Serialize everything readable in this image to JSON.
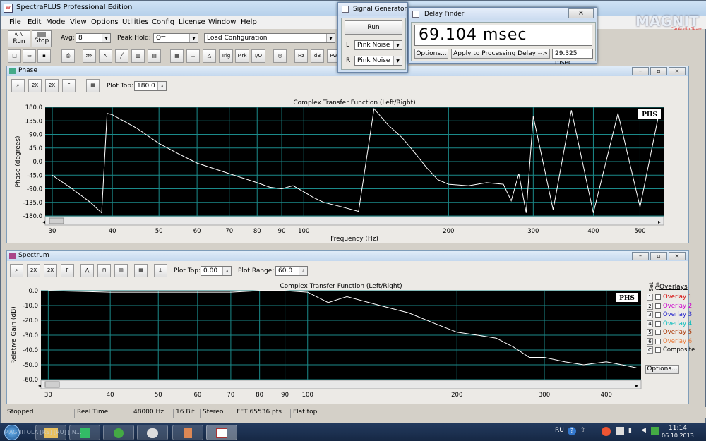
{
  "app": {
    "title": "SpectraPLUS Professional Edition"
  },
  "menu": [
    "File",
    "Edit",
    "Mode",
    "View",
    "Options",
    "Utilities",
    "Config",
    "License",
    "Window",
    "Help"
  ],
  "toolbar": {
    "run_label": "Run",
    "stop_label": "Stop",
    "avg_label": "Avg:",
    "avg_value": "8",
    "peak_label": "Peak Hold:",
    "peak_value": "Off",
    "config_value": "Load Configuration",
    "icons": [
      "Trig",
      "Mrk",
      "I/O",
      "Hz",
      "dB",
      "Pw"
    ]
  },
  "signal_generator": {
    "title": "Signal Generator",
    "run_label": "Run",
    "l_label": "L",
    "l_value": "Pink Noise",
    "r_label": "R",
    "r_value": "Pink Noise"
  },
  "delay_finder": {
    "title": "Delay Finder",
    "readout": "69.104 msec",
    "options_label": "Options...",
    "apply_label": "Apply to Processing Delay -->",
    "delay_value": "29.325 msec"
  },
  "watermark": {
    "brand": "MAGNIT",
    "sub": "CarAudio Team"
  },
  "phase": {
    "window_title": "Phase",
    "plot_top_label": "Plot Top:",
    "plot_top_value": "180.0",
    "chart_title": "Complex Transfer Function (Left/Right)",
    "ylabel": "Phase (degrees)",
    "xlabel": "Frequency (Hz)",
    "badge": "PHS",
    "yticks": [
      "180.0",
      "135.0",
      "90.0",
      "45.0",
      "0.0",
      "-45.0",
      "-90.0",
      "-135.0",
      "-180.0"
    ],
    "xticks": [
      "30",
      "40",
      "50",
      "60",
      "70",
      "80",
      "90",
      "100",
      "200",
      "300",
      "400",
      "500"
    ]
  },
  "spectrum": {
    "window_title": "Spectrum",
    "plot_top_label": "Plot Top:",
    "plot_top_value": "0.00",
    "plot_range_label": "Plot Range:",
    "plot_range_value": "60.0",
    "chart_title": "Complex Transfer Function (Left/Right)",
    "ylabel": "Relative Gain (dB)",
    "badge": "PHS",
    "yticks": [
      "0.0",
      "-10.0",
      "-20.0",
      "-30.0",
      "-40.0",
      "-50.0",
      "-60.0"
    ],
    "xticks": [
      "30",
      "40",
      "50",
      "60",
      "70",
      "80",
      "90",
      "100",
      "200",
      "300",
      "400"
    ],
    "overlays_title": "Overlays",
    "set_label": "Set",
    "on_label": "On",
    "overlays": [
      {
        "num": "1",
        "name": "Overlay 1",
        "color": "#d40000"
      },
      {
        "num": "2",
        "name": "Overlay 2",
        "color": "#cc00cc"
      },
      {
        "num": "3",
        "name": "Overlay 3",
        "color": "#2222cc"
      },
      {
        "num": "4",
        "name": "Overlay 4",
        "color": "#00bbbb"
      },
      {
        "num": "5",
        "name": "Overlay 5",
        "color": "#aa3300"
      },
      {
        "num": "6",
        "name": "Overlay 6",
        "color": "#e87a3a"
      },
      {
        "num": "C",
        "name": "Composite",
        "color": "#000000"
      }
    ],
    "options_label": "Options..."
  },
  "status": [
    "Stopped",
    "Real Time",
    "48000 Hz",
    "16 Bit",
    "Stereo",
    "FFT 65536 pts",
    "Flat top"
  ],
  "taskbar": {
    "text": "MAGNITOLA [RS] [RU] [.N...",
    "lang": "RU",
    "time": "11:14",
    "date": "06.10.2013"
  },
  "chart_data": [
    {
      "type": "line",
      "title": "Complex Transfer Function (Left/Right)",
      "xlabel": "Frequency (Hz)",
      "ylabel": "Phase (degrees)",
      "x_scale": "log",
      "xlim": [
        29,
        560
      ],
      "ylim": [
        -180,
        180
      ],
      "series": [
        {
          "x": [
            30,
            33,
            36,
            38,
            39,
            40,
            45,
            50,
            55,
            60,
            70,
            80,
            85,
            90,
            95,
            100,
            105,
            110,
            120,
            130,
            140,
            150,
            160,
            170,
            180,
            190,
            200,
            220,
            240,
            260,
            270,
            280,
            290,
            300,
            330,
            360,
            400,
            450,
            500,
            550
          ],
          "y": [
            -45,
            -90,
            -135,
            -170,
            160,
            155,
            110,
            60,
            25,
            -5,
            -40,
            -70,
            -85,
            -90,
            -80,
            -100,
            -120,
            -135,
            -150,
            -165,
            175,
            120,
            80,
            30,
            -20,
            -60,
            -75,
            -80,
            -70,
            -75,
            -130,
            -40,
            -170,
            150,
            -160,
            170,
            -170,
            160,
            -150,
            175
          ]
        }
      ]
    },
    {
      "type": "line",
      "title": "Complex Transfer Function (Left/Right)",
      "ylabel": "Relative Gain (dB)",
      "x_scale": "log",
      "xlim": [
        29,
        470
      ],
      "ylim": [
        -60,
        0
      ],
      "series": [
        {
          "x": [
            30,
            40,
            50,
            60,
            70,
            80,
            90,
            100,
            110,
            120,
            140,
            160,
            180,
            200,
            220,
            240,
            260,
            280,
            300,
            330,
            360,
            400,
            430,
            460
          ],
          "y": [
            0,
            -1,
            -1,
            -1,
            -1,
            0,
            0,
            -1,
            -8,
            -4,
            -10,
            -15,
            -22,
            -28,
            -30,
            -32,
            -38,
            -45,
            -45,
            -48,
            -50,
            -48,
            -50,
            -52
          ]
        }
      ]
    }
  ]
}
